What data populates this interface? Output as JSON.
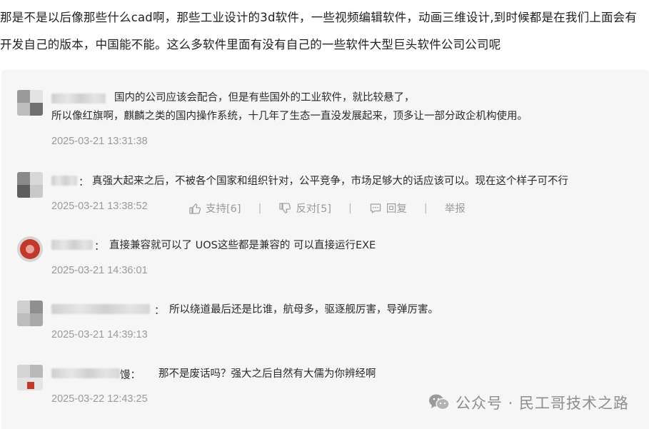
{
  "question": {
    "text": "那是不是以后像那些什么cad啊，那些工业设计的3d软件，一些视频编辑软件，动画三维设计,到时候都是在我们上面会有开发自己的版本，中国能不能。这么多软件里面有没有自己的一些软件大型巨头软件公司公司呢"
  },
  "comments": [
    {
      "line1": "国内的公司应该会配合，但是有些国外的工业软件，就比较悬了，",
      "line2": "所以像红旗啊，麒麟之类的国内操作系统，十几年了生态一直没发展起来，顶多让一部分政企机构使用。",
      "time": "2025-03-21 13:31:38"
    },
    {
      "line1": "真强大起来之后，不被各个国家和组织针对，公平竞争，市场足够大的话应该可以。现在这个样子可不行",
      "time": "2025-03-21 13:38:52",
      "actions": {
        "like": "支持[6]",
        "dislike": "反对[5]",
        "reply": "回复",
        "report": "举报",
        "sep": "|"
      }
    },
    {
      "line1": "直接兼容就可以了 UOS这些都是兼容的 可以直接运行EXE",
      "time": "2025-03-21 14:36:01"
    },
    {
      "line1": "所以绕道最后还是比谁，航母多，驱逐舰厉害，导弹厉害。",
      "time": "2025-03-21 14:39:13"
    },
    {
      "name_partial": "馒：",
      "line1": "那不是废话吗？强大之后自然有大儒为你辨经啊",
      "time": "2025-03-22 12:43:25"
    }
  ],
  "watermark": {
    "text": "公众号 · 民工哥技术之路"
  },
  "colon": "："
}
